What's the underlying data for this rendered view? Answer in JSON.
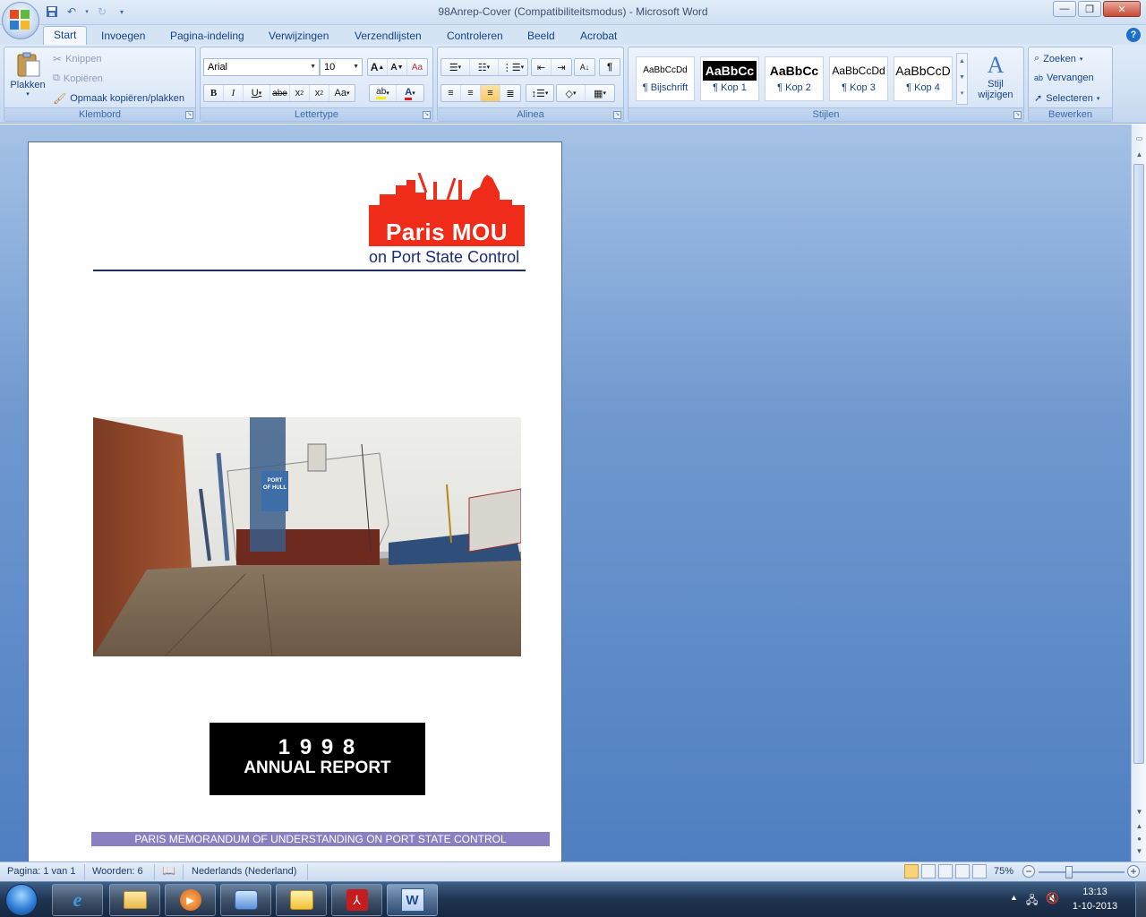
{
  "window": {
    "title": "98Anrep-Cover (Compatibiliteitsmodus) - Microsoft Word"
  },
  "tabs": [
    {
      "label": "Start"
    },
    {
      "label": "Invoegen"
    },
    {
      "label": "Pagina-indeling"
    },
    {
      "label": "Verwijzingen"
    },
    {
      "label": "Verzendlijsten"
    },
    {
      "label": "Controleren"
    },
    {
      "label": "Beeld"
    },
    {
      "label": "Acrobat"
    }
  ],
  "ribbon": {
    "clipboard": {
      "paste": "Plakken",
      "cut": "Knippen",
      "copy": "Kopiëren",
      "format_painter": "Opmaak kopiëren/plakken",
      "label": "Klembord"
    },
    "font": {
      "family": "Arial",
      "size": "10",
      "label": "Lettertype"
    },
    "paragraph": {
      "label": "Alinea"
    },
    "styles": {
      "items": [
        {
          "sample": "AaBbCcDd",
          "name": "¶ Bijschrift"
        },
        {
          "sample": "AaBbCc",
          "name": "¶ Kop 1"
        },
        {
          "sample": "AaBbCc",
          "name": "¶ Kop 2"
        },
        {
          "sample": "AaBbCcDd",
          "name": "¶ Kop 3"
        },
        {
          "sample": "AaBbCcD",
          "name": "¶ Kop 4"
        }
      ],
      "change_style": "Stijl wijzigen",
      "label": "Stijlen"
    },
    "editing": {
      "find": "Zoeken",
      "replace": "Vervangen",
      "select": "Selecteren",
      "label": "Bewerken"
    }
  },
  "document": {
    "logo_title": "Paris MOU",
    "logo_subtitle": "on Port State Control",
    "photo_sign": "PORT OF HULL",
    "report_year": "1 9 9 8",
    "report_title": "ANNUAL REPORT",
    "footer_banner": "PARIS MEMORANDUM OF UNDERSTANDING ON PORT STATE CONTROL"
  },
  "statusbar": {
    "page": "Pagina: 1 van 1",
    "words": "Woorden: 6",
    "language": "Nederlands (Nederland)",
    "zoom": "75%"
  },
  "taskbar": {
    "time": "13:13",
    "date": "1-10-2013"
  },
  "colors": {
    "logo_red": "#ef2b1a",
    "rule_navy": "#1c2a7c",
    "banner_purple": "#8a7fc0"
  }
}
